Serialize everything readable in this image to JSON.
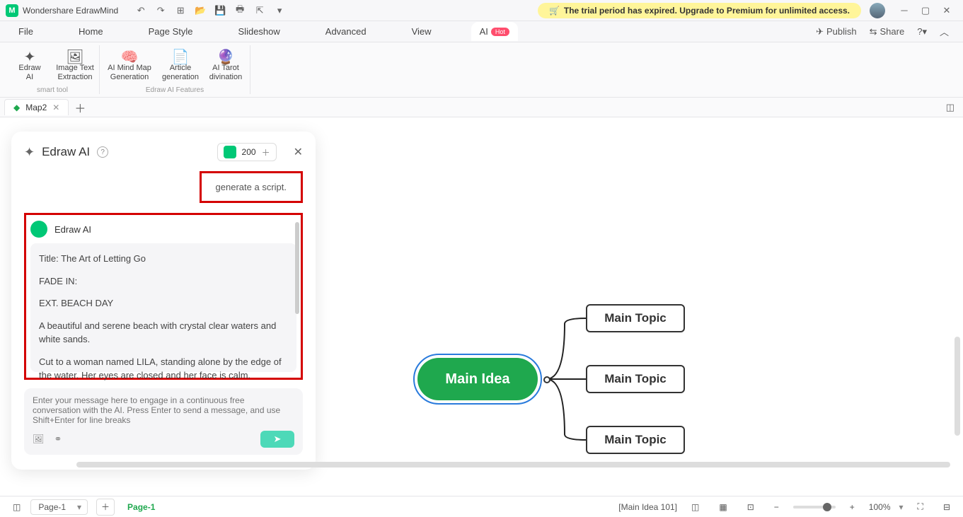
{
  "app": {
    "title": "Wondershare EdrawMind"
  },
  "trial": {
    "text": "The trial period has expired. Upgrade to Premium for unlimited access."
  },
  "menu": {
    "file": "File",
    "home": "Home",
    "page_style": "Page Style",
    "slideshow": "Slideshow",
    "advanced": "Advanced",
    "view": "View",
    "ai": "AI",
    "hot": "Hot",
    "publish": "Publish",
    "share": "Share"
  },
  "ribbon": {
    "smart_tool": "smart tool",
    "features": "Edraw AI Features",
    "edraw_ai": "Edraw\nAI",
    "image_text": "Image Text\nExtraction",
    "mindmap": "AI Mind Map\nGeneration",
    "article": "Article\ngeneration",
    "tarot": "AI Tarot\ndivination"
  },
  "tabs": {
    "map2": "Map2"
  },
  "ai_panel": {
    "title": "Edraw AI",
    "count": "200",
    "prompt": "generate a script.",
    "name": "Edraw AI",
    "msg_title": "Title: The Art of Letting Go",
    "msg_fade": "FADE IN:",
    "msg_scene": "EXT. BEACH  DAY",
    "msg_p1": "A beautiful and serene beach with crystal clear waters and white sands.",
    "msg_p2": "Cut to a woman named LILA, standing alone by the edge of the water. Her eyes are closed and her face is calm.",
    "placeholder": "Enter your message here to engage in a continuous free conversation with the AI. Press Enter to send a message, and use Shift+Enter for line breaks"
  },
  "mindmap": {
    "idea": "Main Idea",
    "topic1": "Main Topic",
    "topic2": "Main Topic",
    "topic3": "Main Topic"
  },
  "status": {
    "page_sel": "Page-1",
    "page_lbl": "Page-1",
    "info": "[Main Idea 101]",
    "zoom": "100%",
    "plus": "+",
    "minus": "−"
  }
}
